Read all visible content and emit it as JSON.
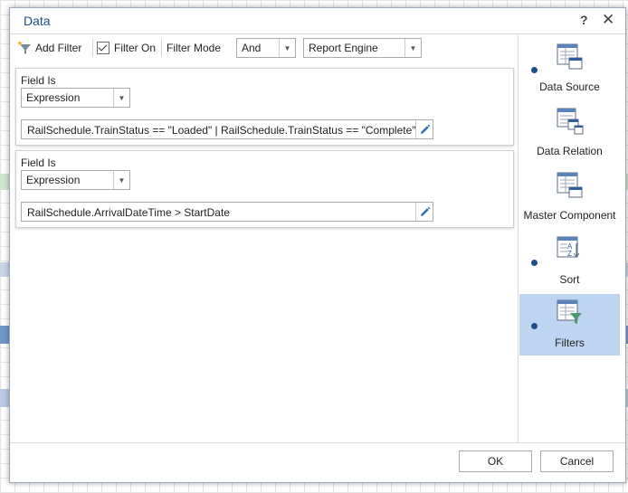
{
  "dialog": {
    "title": "Data"
  },
  "toolbar": {
    "add_filter_label": "Add Filter",
    "filter_on_label": "Filter On",
    "filter_on_checked": true,
    "filter_mode_label": "Filter Mode",
    "filter_mode_value": "And",
    "engine_value": "Report Engine"
  },
  "filters": [
    {
      "field_label": "Field Is",
      "field_value": "Expression",
      "expression": "RailSchedule.TrainStatus == \"Loaded\" | RailSchedule.TrainStatus == \"Complete\""
    },
    {
      "field_label": "Field Is",
      "field_value": "Expression",
      "expression": "RailSchedule.ArrivalDateTime > StartDate"
    }
  ],
  "sidebar": {
    "items": [
      {
        "label": "Data Source",
        "has_dot": true,
        "active": false,
        "icon": "data-source-icon"
      },
      {
        "label": "Data Relation",
        "has_dot": false,
        "active": false,
        "icon": "data-relation-icon"
      },
      {
        "label": "Master Component",
        "has_dot": false,
        "active": false,
        "icon": "master-component-icon"
      },
      {
        "label": "Sort",
        "has_dot": true,
        "active": false,
        "icon": "sort-icon"
      },
      {
        "label": "Filters",
        "has_dot": true,
        "active": true,
        "icon": "filters-icon"
      }
    ]
  },
  "buttons": {
    "ok": "OK",
    "cancel": "Cancel"
  },
  "colors": {
    "accent": "#1c4f8a",
    "active_bg": "#bed5f1"
  }
}
